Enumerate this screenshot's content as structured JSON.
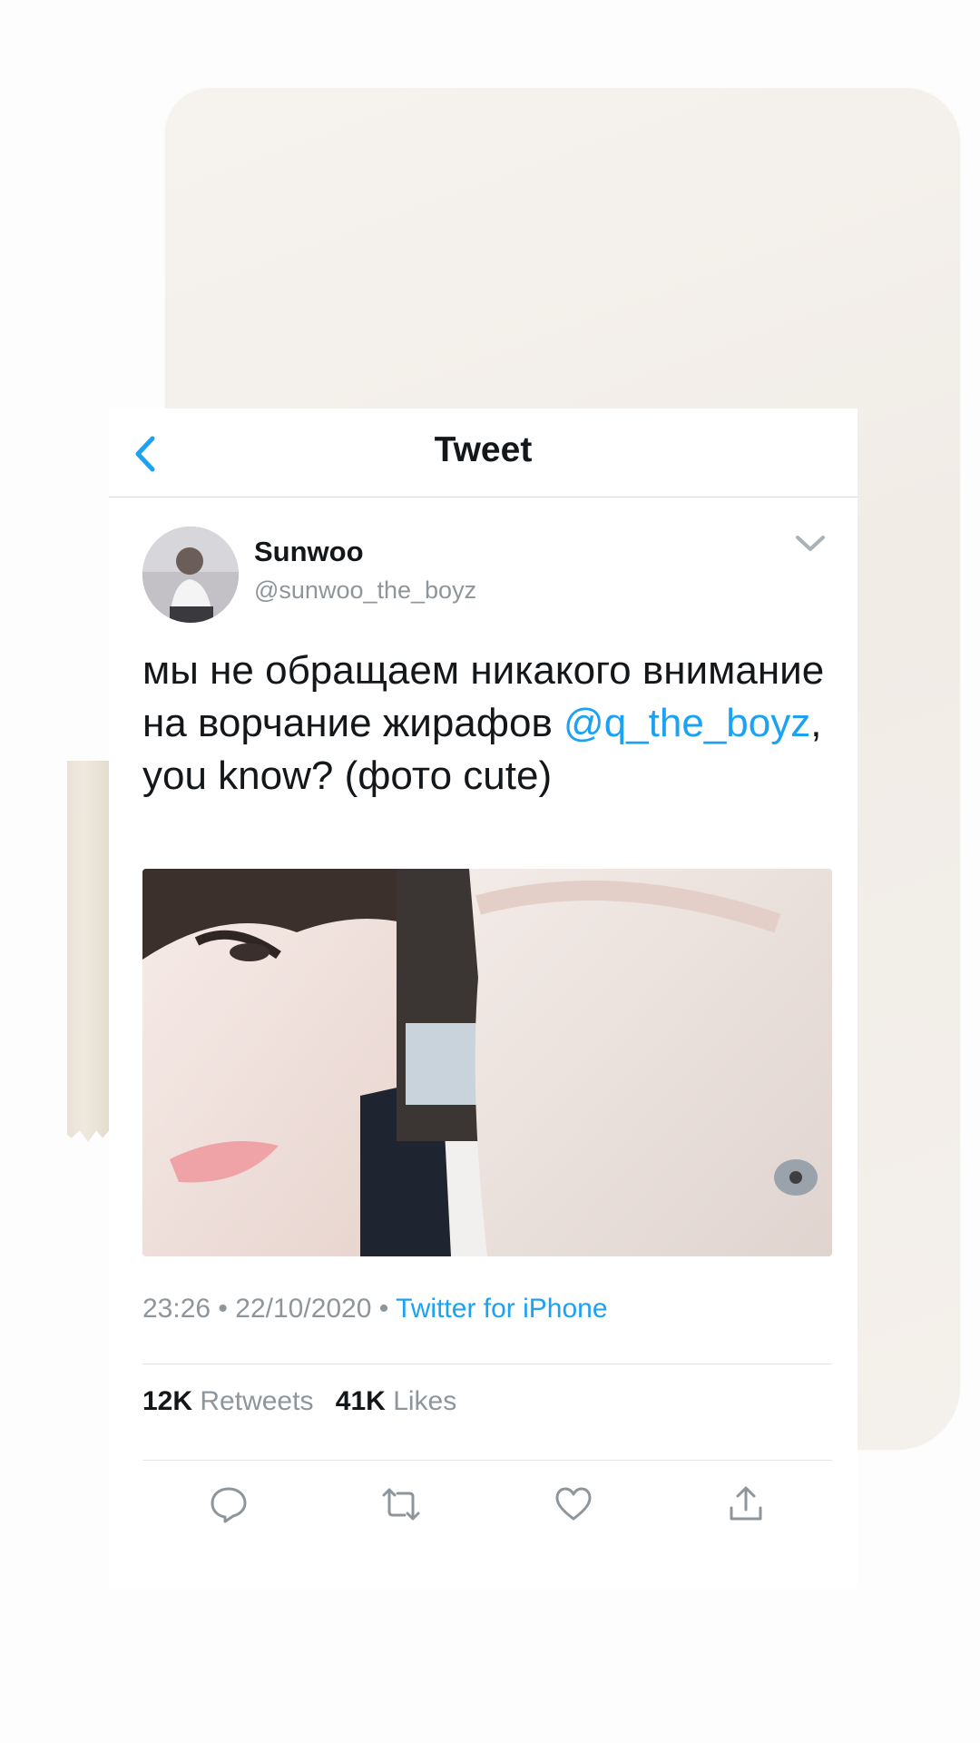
{
  "header": {
    "title": "Tweet",
    "back_icon": "chevron-left-icon"
  },
  "user": {
    "name": "Sunwoo",
    "handle": "@sunwoo_the_boyz"
  },
  "tweet": {
    "text_part1": "мы не обращаем никакого внимание на ворчание жирафов ",
    "mention": "@q_the_boyz",
    "text_part2": ", you know? (фото cute)"
  },
  "meta": {
    "time": "23:26",
    "date": "22/10/2020",
    "source": "Twitter for iPhone"
  },
  "stats": {
    "retweets_count": "12K",
    "retweets_label": "Retweets",
    "likes_count": "41K",
    "likes_label": "Likes"
  },
  "actions": [
    "reply-icon",
    "retweet-icon",
    "like-icon",
    "share-icon"
  ],
  "colors": {
    "accent": "#1da1f2",
    "text": "#14171a",
    "secondary": "#8e959b"
  }
}
